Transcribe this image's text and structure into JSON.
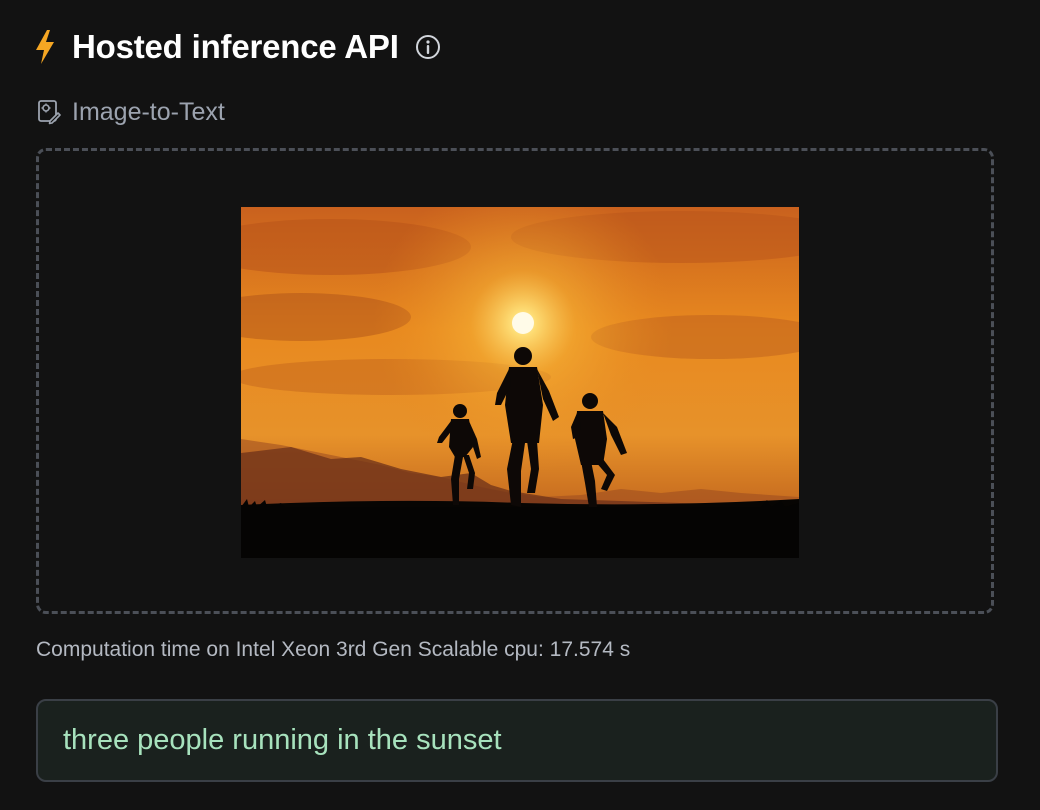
{
  "header": {
    "title": "Hosted inference API",
    "accent_color": "#f5a623",
    "icons": [
      "bolt-icon",
      "info-icon"
    ]
  },
  "task": {
    "label": "Image-to-Text",
    "icon": "task-image-icon"
  },
  "input": {
    "image_subject": "three runners silhouetted against a sunset"
  },
  "result": {
    "computation_time": "Computation time on Intel Xeon 3rd Gen Scalable cpu: 17.574 s",
    "output_text": "three people running in the sunset"
  },
  "colors": {
    "background": "#121212",
    "output_text": "#a7e2bd",
    "output_bg": "#1a211e"
  }
}
